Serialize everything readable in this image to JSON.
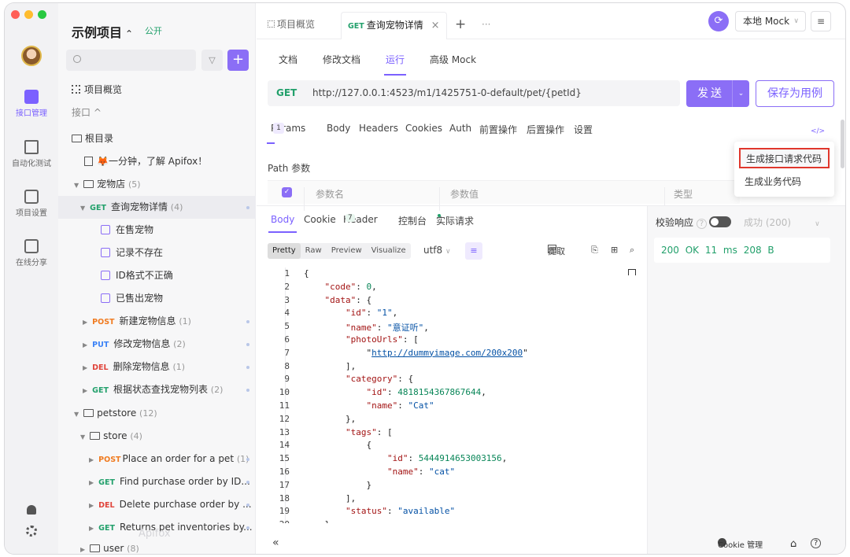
{
  "window": {
    "traffic_colors": [
      "#ff5f57",
      "#febc2e",
      "#28c840"
    ]
  },
  "rail": {
    "items": [
      {
        "label": "接口管理"
      },
      {
        "label": "自动化测试"
      },
      {
        "label": "项目设置"
      },
      {
        "label": "在线分享"
      }
    ]
  },
  "sidebar": {
    "project_title": "示例项目",
    "project_chevron": "⌃",
    "visibility": "公开",
    "filter_icon": "▽",
    "add_icon": "+",
    "overview": "项目概览",
    "api_section": "接口",
    "api_section_chevron": "^",
    "root_dir": "根目录",
    "intro_doc": "🦊一分钟，了解 Apifox！",
    "petshop": {
      "name": "宠物店",
      "count": "(5)"
    },
    "selected_api": {
      "method": "GET",
      "name": "查询宠物详情",
      "count": "(4)"
    },
    "cases": [
      "在售宠物",
      "记录不存在",
      "ID格式不正确",
      "已售出宠物"
    ],
    "apis": [
      {
        "method": "POST",
        "name": "新建宠物信息",
        "count": "(1)"
      },
      {
        "method": "PUT",
        "name": "修改宠物信息",
        "count": "(2)"
      },
      {
        "method": "DEL",
        "name": "删除宠物信息",
        "count": "(1)"
      },
      {
        "method": "GET",
        "name": "根据状态查找宠物列表",
        "count": "(2)"
      }
    ],
    "petstore": {
      "name": "petstore",
      "count": "(12)"
    },
    "store": {
      "name": "store",
      "count": "(4)"
    },
    "store_apis": [
      {
        "method": "POST",
        "name": "Place an order for a pet",
        "count": "(1)"
      },
      {
        "method": "GET",
        "name": "Find purchase order by ID...",
        "count": ""
      },
      {
        "method": "DEL",
        "name": "Delete purchase order by ...",
        "count": ""
      },
      {
        "method": "GET",
        "name": "Returns pet inventories by...",
        "count": ""
      }
    ],
    "user": {
      "name": "user",
      "count": "(8)"
    },
    "watermark": "Apifox"
  },
  "topbar": {
    "tabs": [
      {
        "label": "项目概览"
      },
      {
        "method": "GET",
        "label": "查询宠物详情",
        "close": "×"
      }
    ],
    "new_tab": "+",
    "more_tabs": "···",
    "sync_icon": "⟳",
    "env": "本地 Mock",
    "env_chevron": "∨",
    "menu_icon": "≡"
  },
  "subtabs": [
    "文档",
    "修改文档",
    "运行",
    "高级 Mock"
  ],
  "request": {
    "method": "GET",
    "url": "http://127.0.0.1:4523/m1/1425751-0-default/pet/{petId}",
    "send": "发送",
    "send_dropdown": "⌄",
    "save": "保存为用例"
  },
  "param_tabs": [
    {
      "label": "Params",
      "badge": "1"
    },
    {
      "label": "Body"
    },
    {
      "label": "Headers"
    },
    {
      "label": "Cookies"
    },
    {
      "label": "Auth"
    },
    {
      "label": "前置操作"
    },
    {
      "label": "后置操作"
    },
    {
      "label": "设置"
    }
  ],
  "code_icon": "</>",
  "path_params": {
    "label": "Path 参数",
    "checkbox": "✓",
    "columns": [
      "参数名",
      "参数值",
      "类型"
    ]
  },
  "popup_menu": [
    "生成接口请求代码",
    "生成业务代码"
  ],
  "response": {
    "tabs": [
      {
        "label": "Body"
      },
      {
        "label": "Cookie"
      },
      {
        "label": "Header",
        "badge": "7"
      },
      {
        "label": "控制台"
      },
      {
        "label": "实际请求"
      }
    ],
    "view_modes": [
      "Pretty",
      "Raw",
      "Preview",
      "Visualize"
    ],
    "encoding": "utf8",
    "encoding_chevron": "∨",
    "wrap_icon": "≡",
    "extract": "提取",
    "tool_icons": [
      "⊞",
      "⎘",
      "⌕"
    ],
    "collapse_icon": "«",
    "code_lines": [
      "{",
      "    \"code\": 0,",
      "    \"data\": {",
      "        \"id\": \"1\",",
      "        \"name\": \"意证听\",",
      "        \"photoUrls\": [",
      "            \"http://dummyimage.com/200x200\"",
      "        ],",
      "        \"category\": {",
      "            \"id\": 4818154367867644,",
      "            \"name\": \"Cat\"",
      "        },",
      "        \"tags\": [",
      "            {",
      "                \"id\": 5444914653003156,",
      "                \"name\": \"cat\"",
      "            }",
      "        ],",
      "        \"status\": \"available\"",
      "    }"
    ]
  },
  "validation": {
    "label": "校验响应",
    "help": "?",
    "result": "成功 (200)",
    "chevron": "∨",
    "status_line": "200 OK  11 ms  208 B"
  },
  "footer": {
    "cookie": "Cookie 管理",
    "shirt": "⌂",
    "help": "?"
  }
}
